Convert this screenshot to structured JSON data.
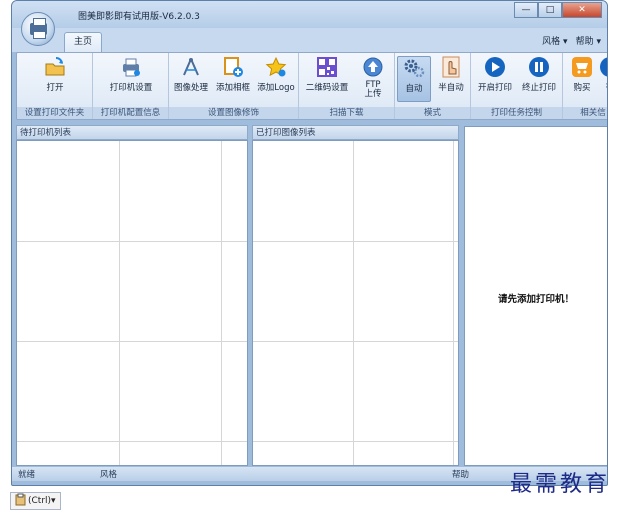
{
  "window": {
    "title": "图美即影即有试用版-V6.2.0.3",
    "minimize": "—",
    "maximize": "□",
    "close": "✕"
  },
  "tabs": {
    "home": "主页",
    "style": "风格",
    "help": "帮助"
  },
  "ribbon": {
    "groups": [
      {
        "label": "设置打印文件夹",
        "buttons": [
          "打开"
        ]
      },
      {
        "label": "打印机配置信息",
        "buttons": [
          "打印机设置"
        ]
      },
      {
        "label": "设置图像修饰",
        "buttons": [
          "图像处理",
          "添加相框",
          "添加Logo"
        ]
      },
      {
        "label": "扫描下载",
        "buttons": [
          "二维码设置",
          "FTP\n上传"
        ]
      },
      {
        "label": "模式",
        "buttons": [
          "自动",
          "半自动"
        ]
      },
      {
        "label": "打印任务控制",
        "buttons": [
          "开启打印",
          "终止打印"
        ]
      },
      {
        "label": "相关信",
        "buttons": [
          "购买",
          "帮"
        ]
      }
    ],
    "ftp_line1": "FTP",
    "ftp_line2": "上传"
  },
  "panes": {
    "pending_header": "待打印机列表",
    "printed_header": "已打印图像列表",
    "message": "请先添加打印机！"
  },
  "status": {
    "ready": "就绪",
    "style": "风格",
    "help": "帮助"
  },
  "watermark": "最需教育",
  "clipboard_chip": "(Ctrl)▾",
  "colors": {
    "frame": "#9fbcdc",
    "ribbon_label": "#c4d6ec",
    "accent_blue": "#1565c0"
  }
}
